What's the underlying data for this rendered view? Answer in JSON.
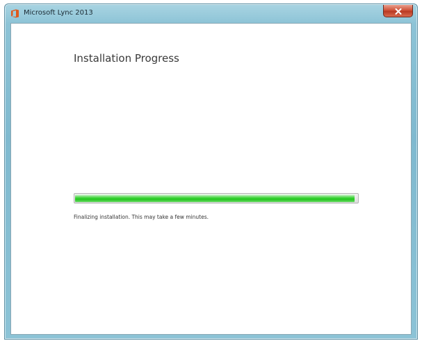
{
  "window": {
    "title": "Microsoft Lync 2013",
    "app_icon": "office-icon",
    "close_icon": "close-icon",
    "colors": {
      "office_orange": "#e05a1c",
      "close_red": "#c8472c",
      "progress_green": "#2fcf2a"
    }
  },
  "content": {
    "heading": "Installation Progress",
    "progress_percent": 99,
    "status": "Finalizing installation. This may take a few minutes."
  }
}
